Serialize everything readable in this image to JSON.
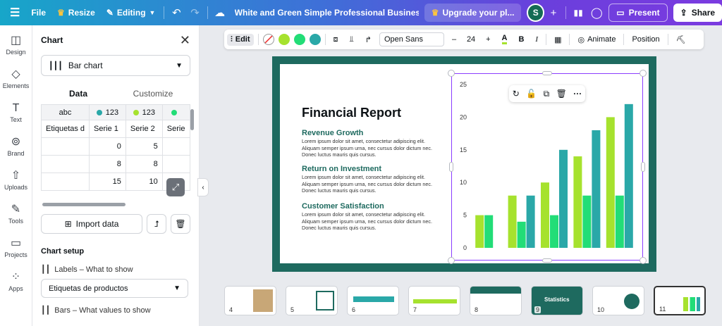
{
  "topbar": {
    "menu_icon": "hamburger-icon",
    "file": "File",
    "resize": "Resize",
    "editing": "Editing",
    "title": "White and Green Simple  Professional Business Project Pre...",
    "upgrade": "Upgrade your pl...",
    "avatar": "S",
    "present": "Present",
    "share": "Share"
  },
  "rail": [
    {
      "label": "Design",
      "icon": "design-icon"
    },
    {
      "label": "Elements",
      "icon": "elements-icon"
    },
    {
      "label": "Text",
      "icon": "text-icon"
    },
    {
      "label": "Brand",
      "icon": "brand-icon"
    },
    {
      "label": "Uploads",
      "icon": "uploads-icon"
    },
    {
      "label": "Tools",
      "icon": "tools-icon"
    },
    {
      "label": "Projects",
      "icon": "projects-icon"
    },
    {
      "label": "Apps",
      "icon": "apps-icon"
    }
  ],
  "panel": {
    "title": "Chart",
    "chart_type": "Bar chart",
    "tabs": [
      "Data",
      "Customize"
    ],
    "grid": {
      "head_types": [
        "abc",
        "123",
        "123",
        ""
      ],
      "head_colors": [
        "#2aa8a8",
        "#a6e22e",
        "#22dd77"
      ],
      "columns": [
        "Etiquetas d",
        "Serie 1",
        "Serie 2",
        "Serie"
      ],
      "rows": [
        [
          "",
          "0",
          "5",
          ""
        ],
        [
          "",
          "8",
          "8",
          ""
        ],
        [
          "",
          "15",
          "10",
          ""
        ]
      ]
    },
    "import_data": "Import data",
    "chart_setup": "Chart setup",
    "labels_heading": "Labels – What to show",
    "labels_value": "Etiquetas de productos",
    "bars_heading": "Bars – What values to show"
  },
  "toolbar": {
    "edit": "Edit",
    "colors": [
      "#a6e22e",
      "#22dd77",
      "#2aa8a8"
    ],
    "font": "Open Sans",
    "font_size": "24",
    "bold": "B",
    "italic": "I",
    "animate": "Animate",
    "position": "Position"
  },
  "slide": {
    "title": "Financial Report",
    "sections": [
      {
        "heading": "Revenue Growth",
        "body": "Lorem ipsum dolor sit amet, consectetur adipiscing elit. Aliquam semper ipsum urna, nec cursus dolor dictum nec. Donec luctus mauris quis cursus."
      },
      {
        "heading": "Return on Investment",
        "body": "Lorem ipsum dolor sit amet, consectetur adipiscing elit. Aliquam semper ipsum urna, nec cursus dolor dictum nec. Donec luctus mauris quis cursus."
      },
      {
        "heading": "Customer Satisfaction",
        "body": "Lorem ipsum dolor sit amet, consectetur adipiscing elit. Aliquam semper ipsum urna, nec cursus dolor dictum nec. Donec luctus mauris quis cursus."
      }
    ]
  },
  "chart_data": {
    "type": "bar",
    "categories": [
      "",
      "",
      "",
      "",
      ""
    ],
    "series": [
      {
        "color": "#a6e22e",
        "values": [
          5,
          8,
          10,
          14,
          20
        ]
      },
      {
        "color": "#22dd77",
        "values": [
          5,
          4,
          5,
          8,
          8
        ]
      },
      {
        "color": "#2aa8a8",
        "values": [
          0,
          8,
          15,
          18,
          22
        ]
      }
    ],
    "ylim": [
      0,
      25
    ],
    "yticks": [
      "0",
      "5",
      "10",
      "15",
      "20",
      "25"
    ],
    "grid": false,
    "legend": "none"
  },
  "thumbnails": [
    {
      "num": "4",
      "bg": "#ffffff",
      "accent": "#1e6a5f"
    },
    {
      "num": "5",
      "bg": "#ffffff",
      "accent": "#1e6a5f"
    },
    {
      "num": "6",
      "bg": "#ffffff",
      "accent": "#1e6a5f"
    },
    {
      "num": "7",
      "bg": "#ffffff",
      "accent": "#1e6a5f"
    },
    {
      "num": "8",
      "bg": "#ffffff",
      "accent": "#1e6a5f"
    },
    {
      "num": "9",
      "bg": "#1e6a5f",
      "accent": "#ffffff",
      "text": "Statistics"
    },
    {
      "num": "10",
      "bg": "#ffffff",
      "accent": "#1e6a5f"
    },
    {
      "num": "11",
      "bg": "#ffffff",
      "accent": "#a6e22e"
    }
  ]
}
